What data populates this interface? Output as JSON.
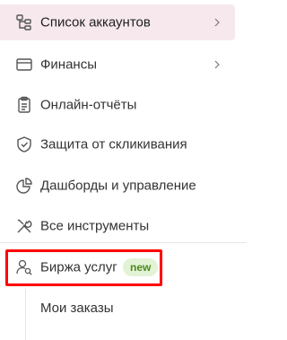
{
  "menu": {
    "items": [
      {
        "label": "Список аккаунтов",
        "icon": "accounts-tree-icon",
        "active": true,
        "has_chevron": true
      },
      {
        "label": "Финансы",
        "icon": "wallet-icon",
        "active": false,
        "has_chevron": true
      },
      {
        "label": "Онлайн-отчёты",
        "icon": "report-clipboard-icon",
        "active": false,
        "has_chevron": false
      },
      {
        "label": "Защита от скликивания",
        "icon": "shield-check-icon",
        "active": false,
        "has_chevron": false
      },
      {
        "label": "Дашборды и управление",
        "icon": "dashboard-pie-icon",
        "active": false,
        "has_chevron": false
      },
      {
        "label": "Все инструменты",
        "icon": "tools-icon",
        "active": false,
        "has_chevron": false
      }
    ],
    "services_exchange": {
      "label": "Биржа услуг",
      "icon": "user-search-icon",
      "badge": "new",
      "highlighted": true
    },
    "my_orders": {
      "label": "Мои заказы"
    }
  },
  "colors": {
    "active_bg": "#f6e8ec",
    "badge_bg": "#e3f3d6",
    "badge_text": "#4b8a1c",
    "highlight_border": "#ff0000"
  }
}
